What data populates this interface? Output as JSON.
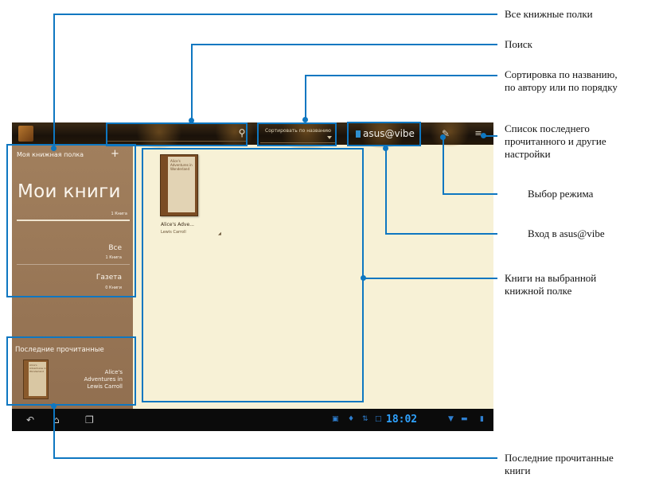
{
  "app": {
    "sort_label": "Сортировать по названию",
    "vibe_label": "asus@vibe"
  },
  "sidebar": {
    "shelf_header": "Моя книжная полка",
    "title": "Мои книги",
    "count": "1 Книга",
    "categories": [
      {
        "label": "Все",
        "count": "1 Книга"
      },
      {
        "label": "Газета",
        "count": "0 Книги"
      }
    ],
    "recent_header": "Последние прочитанные",
    "recent_book": {
      "title_lines": [
        "Alice's",
        "Adventures in"
      ],
      "author": "Lewis Carroll",
      "cover_title": "Alice's Adventures in Wonderland"
    }
  },
  "shelf": {
    "book": {
      "title": "Alice's Adve...",
      "author": "Lewis Carroll",
      "cover_title": "Alice's Adventures in Wonderland"
    }
  },
  "navbar": {
    "clock": "18:02"
  },
  "icons": [
    "app-icon",
    "search-icon",
    "mode-icon",
    "menu-icon",
    "back-icon",
    "home-icon",
    "recent-apps-icon",
    "wifi-icon",
    "battery-icon"
  ],
  "annotations": [
    {
      "text": "Все книжные полки"
    },
    {
      "text": "Поиск"
    },
    {
      "text": "Сортировка по названию,\nпо автору или по порядку"
    },
    {
      "text": "Список последнего\nпрочитанного и другие\nнастройки"
    },
    {
      "text": "Выбор режима"
    },
    {
      "text": "Вход в asus@vibe"
    },
    {
      "text": "Книги на выбранной\nкнижной полке"
    },
    {
      "text": "Последние прочитанные\nкниги"
    }
  ],
  "colors": {
    "callout": "#0e77c1",
    "shelf_bg": "#f7f1d6",
    "sidebar": "#9c7a5a"
  }
}
